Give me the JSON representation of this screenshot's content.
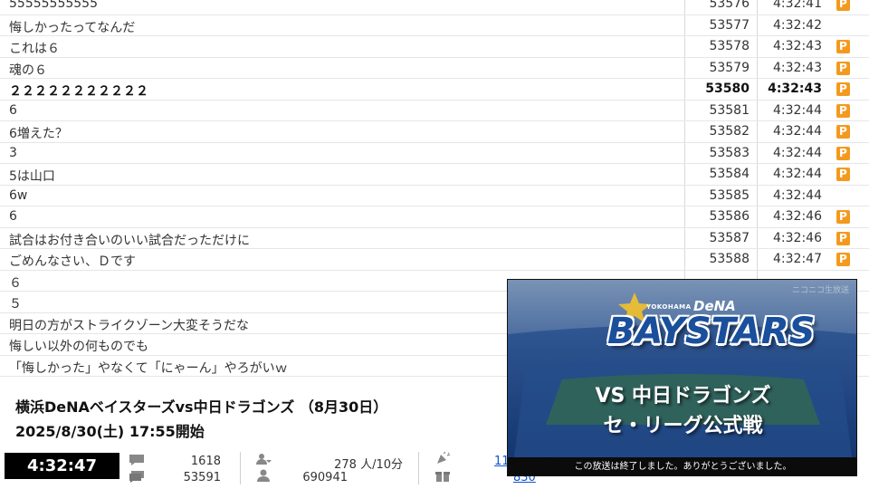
{
  "comments": [
    {
      "text": "55555555555",
      "no": "53576",
      "time": "4:32:41",
      "premium": true,
      "bold": false
    },
    {
      "text": "悔しかったってなんだ",
      "no": "53577",
      "time": "4:32:42",
      "premium": false,
      "bold": false
    },
    {
      "text": "これは６",
      "no": "53578",
      "time": "4:32:43",
      "premium": true,
      "bold": false
    },
    {
      "text": "魂の６",
      "no": "53579",
      "time": "4:32:43",
      "premium": true,
      "bold": false
    },
    {
      "text": "２２２２２２２２２２２",
      "no": "53580",
      "time": "4:32:43",
      "premium": true,
      "bold": true
    },
    {
      "text": "6",
      "no": "53581",
      "time": "4:32:44",
      "premium": true,
      "bold": false
    },
    {
      "text": "6増えた？",
      "no": "53582",
      "time": "4:32:44",
      "premium": true,
      "bold": false
    },
    {
      "text": "3",
      "no": "53583",
      "time": "4:32:44",
      "premium": true,
      "bold": false
    },
    {
      "text": "5は山口",
      "no": "53584",
      "time": "4:32:44",
      "premium": true,
      "bold": false
    },
    {
      "text": "6w",
      "no": "53585",
      "time": "4:32:44",
      "premium": false,
      "bold": false
    },
    {
      "text": "6",
      "no": "53586",
      "time": "4:32:46",
      "premium": true,
      "bold": false
    },
    {
      "text": "試合はお付き合いのいい試合だっただけに",
      "no": "53587",
      "time": "4:32:46",
      "premium": true,
      "bold": false
    },
    {
      "text": "ごめんなさい、Ｄです",
      "no": "53588",
      "time": "4:32:47",
      "premium": true,
      "bold": false
    },
    {
      "text": "６",
      "no": "",
      "time": "",
      "premium": false,
      "bold": false
    },
    {
      "text": "５",
      "no": "",
      "time": "",
      "premium": false,
      "bold": false
    },
    {
      "text": "明日の方がストライクゾーン大変そうだな",
      "no": "",
      "time": "",
      "premium": false,
      "bold": false
    },
    {
      "text": "悔しい以外の何ものでも",
      "no": "",
      "time": "",
      "premium": false,
      "bold": false
    },
    {
      "text": "「悔しかった」やなくて「にゃーん」やろがいｗ",
      "no": "",
      "time": "",
      "premium": false,
      "bold": false
    }
  ],
  "premium_badge": "P",
  "program": {
    "title": "横浜DeNAベイスターズvs中日ドラゴンズ （8月30日）",
    "date": "2025/8/30(土) 17:55開始"
  },
  "stats": {
    "elapsed": "4:32:47",
    "value_a_top": "1618",
    "value_a_bottom": "53591",
    "visitors_top": "278 人/10分",
    "visitors_bottom": "690941",
    "link_top": "11",
    "link_bottom": "830"
  },
  "video": {
    "watermark": "ニコニコ生放送",
    "team_small": "YOKOHAMA",
    "team_brand": "DeNA",
    "team_name": "BAYSTARS",
    "matchup": "VS 中日ドラゴンズ",
    "league": "セ・リーグ公式戦",
    "caption": "この放送は終了しました。ありがとうございました。"
  },
  "colors": {
    "premium": "#f39a1e",
    "clock_bg": "#000000",
    "link": "#1155cc",
    "bay_blue": "#1a4f9c"
  },
  "icons": [
    "comment-icon",
    "comment-stack-icon",
    "user-icon",
    "person-icon",
    "party-popper-icon",
    "gift-icon"
  ]
}
